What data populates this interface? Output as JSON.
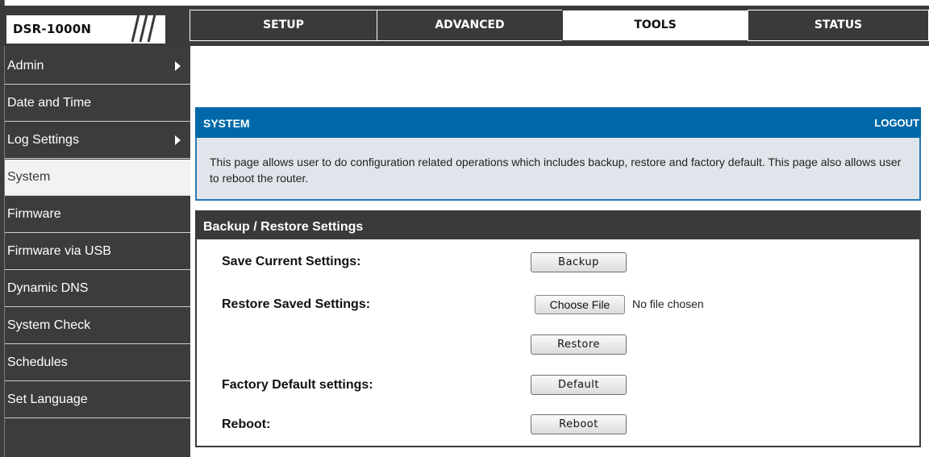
{
  "brand": {
    "model": "DSR-1000N"
  },
  "nav": {
    "tabs": [
      {
        "label": "SETUP"
      },
      {
        "label": "ADVANCED"
      },
      {
        "label": "TOOLS"
      },
      {
        "label": "STATUS"
      }
    ],
    "active": "TOOLS"
  },
  "sidebar": {
    "items": [
      {
        "label": "Admin",
        "has_submenu": true
      },
      {
        "label": "Date and Time",
        "has_submenu": false
      },
      {
        "label": "Log Settings",
        "has_submenu": true
      },
      {
        "label": "System",
        "has_submenu": false
      },
      {
        "label": "Firmware",
        "has_submenu": false
      },
      {
        "label": "Firmware via USB",
        "has_submenu": false
      },
      {
        "label": "Dynamic DNS",
        "has_submenu": false
      },
      {
        "label": "System Check",
        "has_submenu": false
      },
      {
        "label": "Schedules",
        "has_submenu": false
      },
      {
        "label": "Set Language",
        "has_submenu": false
      }
    ],
    "active": "System"
  },
  "system": {
    "title": "SYSTEM",
    "logout": "LOGOUT",
    "description": "This page allows user to do configuration related operations which includes backup, restore and factory default. This page also allows user to reboot the router."
  },
  "backup_restore": {
    "title": "Backup / Restore Settings",
    "save_label": "Save Current Settings:",
    "backup_button": "Backup",
    "restore_label": "Restore Saved Settings:",
    "choose_file_button": "Choose File",
    "file_status": "No file chosen",
    "restore_button": "Restore",
    "factory_label": "Factory Default settings:",
    "default_button": "Default",
    "reboot_label": "Reboot:",
    "reboot_button": "Reboot"
  },
  "colors": {
    "dark_gray": "#3a3a3a",
    "header_blue": "#0068a8",
    "desc_bg": "#dfe5ea",
    "active_side": "#f2f2f2"
  }
}
